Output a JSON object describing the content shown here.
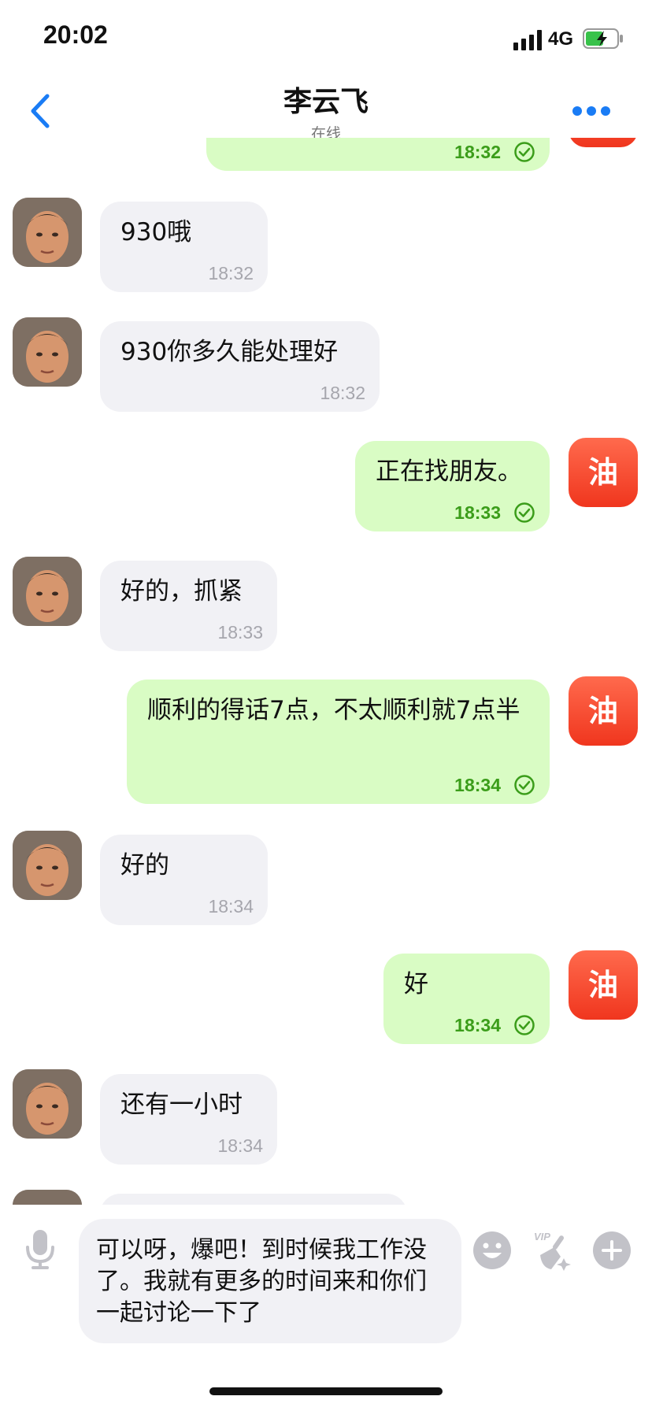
{
  "status_bar": {
    "time": "20:02",
    "network": "4G"
  },
  "header": {
    "title": "李云飞",
    "subtitle": "在线"
  },
  "messages": [
    {
      "side": "out",
      "text": "",
      "time": "18:32"
    },
    {
      "side": "in",
      "text": "930哦",
      "time": "18:32"
    },
    {
      "side": "in",
      "text": "930你多久能处理好",
      "time": "18:32"
    },
    {
      "side": "out",
      "text": "正在找朋友。",
      "time": "18:33"
    },
    {
      "side": "in",
      "text": "好的，抓紧",
      "time": "18:33"
    },
    {
      "side": "out",
      "text": "顺利的得话7点，不太顺利就7点半",
      "time": "18:34"
    },
    {
      "side": "in",
      "text": "好的",
      "time": "18:34"
    },
    {
      "side": "out",
      "text": "好",
      "time": "18:34"
    },
    {
      "side": "in",
      "text": "还有一小时",
      "time": "18:34"
    }
  ],
  "my_avatar_label": "油",
  "composer": {
    "value": "可以呀，爆吧！到时候我工作没了。我就有更多的时间来和你们一起讨论一下了",
    "vip_badge": "VIP"
  },
  "colors": {
    "accent": "#1a7cf5",
    "out_bubble": "#d9fcc4",
    "in_bubble": "#f1f1f5",
    "out_time": "#3b9d1a",
    "my_avatar": "#f0361e"
  }
}
